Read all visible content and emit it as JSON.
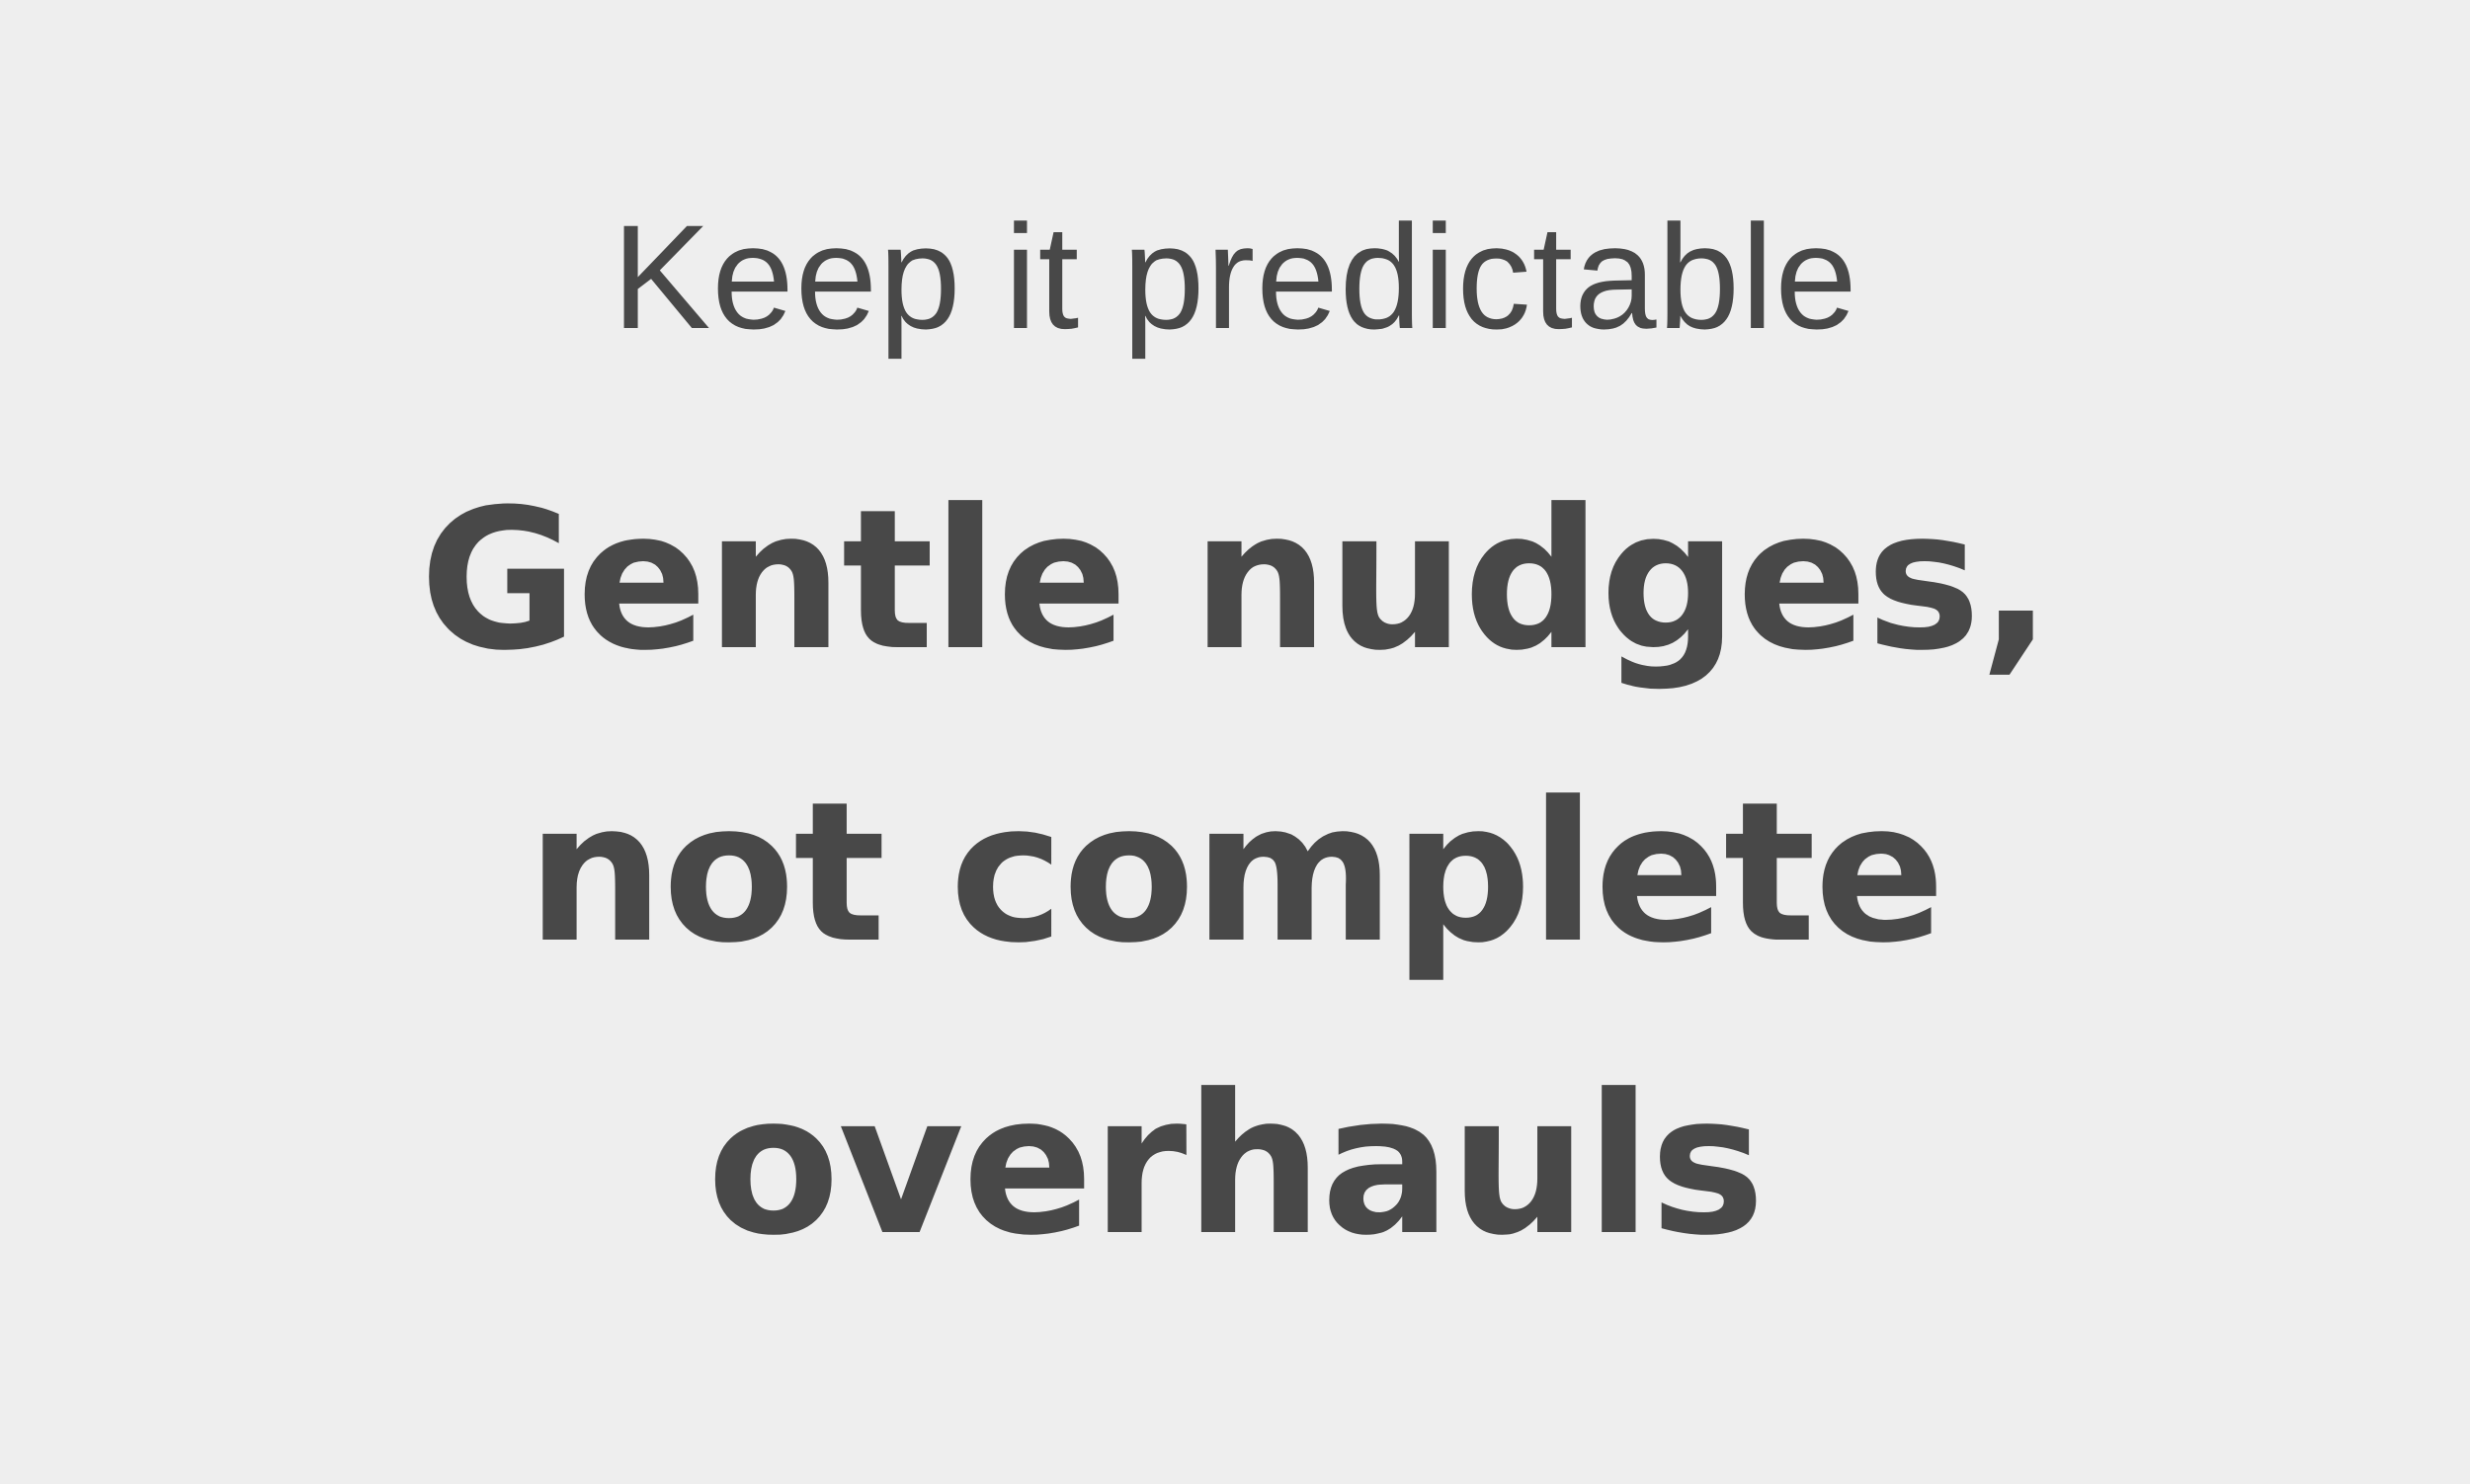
{
  "slide": {
    "subtitle": "Keep it predictable",
    "headline_lines": [
      "Gentle nudges,",
      "not complete",
      "overhauls"
    ],
    "colors": {
      "background": "#eeeeee",
      "text": "#484848"
    }
  }
}
